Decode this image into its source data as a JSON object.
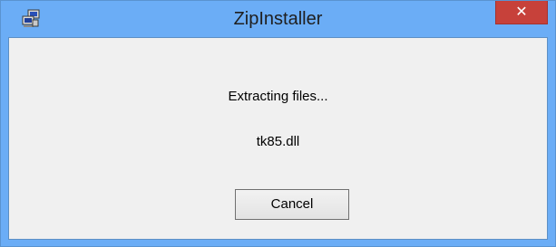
{
  "window": {
    "title": "ZipInstaller",
    "app_icon": "installer-computer-icon",
    "close_icon": "close-icon",
    "close_glyph": "✕",
    "titlebar_color": "#6badf6",
    "close_color": "#c7413a"
  },
  "dialog": {
    "status_text": "Extracting files...",
    "current_file": "tk85.dll",
    "cancel_label": "Cancel"
  }
}
